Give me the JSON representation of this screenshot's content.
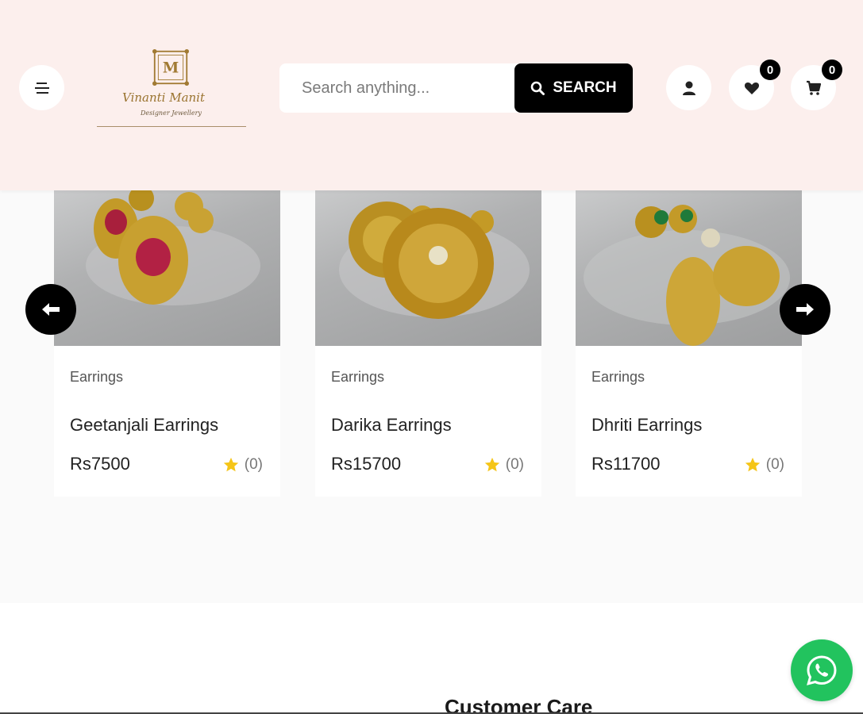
{
  "header": {
    "menu_icon": "hamburger-menu-icon",
    "logo": {
      "monogram": "M",
      "brand": "Vinanti Manit",
      "tagline": "Designer Jewellery"
    },
    "search": {
      "placeholder": "Search anything...",
      "button_label": "SEARCH",
      "button_icon": "search-icon"
    },
    "account_icon": "user-icon",
    "wishlist": {
      "icon": "heart-icon",
      "count": "0"
    },
    "cart": {
      "icon": "cart-icon",
      "count": "0"
    }
  },
  "carousel": {
    "prev_icon": "arrow-left-icon",
    "next_icon": "arrow-right-icon",
    "products": [
      {
        "category": "Earrings",
        "title": "Geetanjali Earrings",
        "price": "Rs7500",
        "rating_count": "(0)",
        "star_icon": "star-icon"
      },
      {
        "category": "Earrings",
        "title": "Darika Earrings",
        "price": "Rs15700",
        "rating_count": "(0)",
        "star_icon": "star-icon"
      },
      {
        "category": "Earrings",
        "title": "Dhriti Earrings",
        "price": "Rs11700",
        "rating_count": "(0)",
        "star_icon": "star-icon"
      }
    ]
  },
  "footer": {
    "section_title": "Customer Care"
  },
  "whatsapp_icon": "whatsapp-icon",
  "colors": {
    "header_bg": "#fcefed",
    "accent": "#000000",
    "star": "#f5c518",
    "whatsapp": "#22c35e",
    "logo_gold": "#9a7430"
  }
}
